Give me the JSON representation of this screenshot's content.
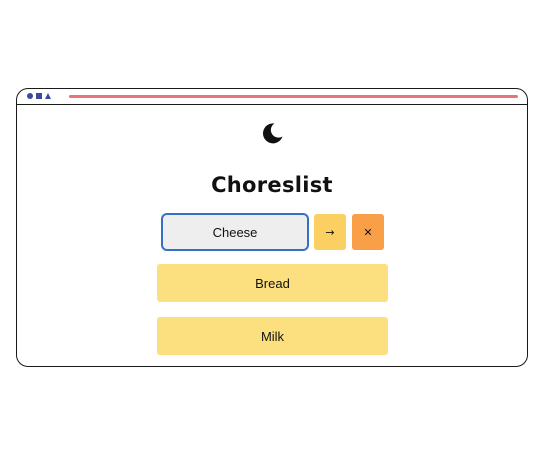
{
  "app": {
    "title": "Choreslist",
    "theme_icon": "moon-icon"
  },
  "input": {
    "value": "Cheese"
  },
  "buttons": {
    "add_label": "→",
    "clear_label": "✕"
  },
  "list": {
    "items": [
      {
        "label": "Bread"
      },
      {
        "label": "Milk"
      }
    ]
  },
  "colors": {
    "accent_yellow": "#fccf63",
    "accent_orange": "#f89f47",
    "item_background": "#fcdf7f",
    "input_border": "#3570c4",
    "url_bar": "#e8737a",
    "window_icons": "#3b4a9c"
  }
}
